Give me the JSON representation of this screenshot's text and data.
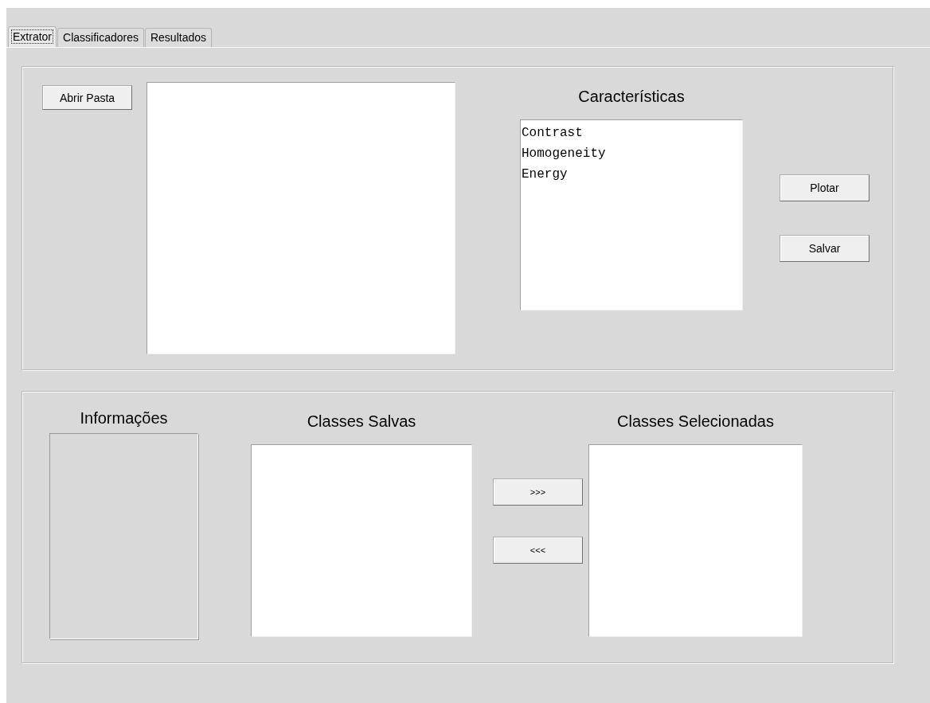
{
  "tabs": [
    {
      "label": "Extrator",
      "selected": true
    },
    {
      "label": "Classificadores",
      "selected": false
    },
    {
      "label": "Resultados",
      "selected": false
    }
  ],
  "extractor": {
    "open_button": "Abrir Pasta",
    "features_title": "Características",
    "features": [
      "Contrast",
      "Homogeneity",
      "Energy"
    ],
    "plot_button": "Plotar",
    "save_button": "Salvar"
  },
  "classes": {
    "info_title": "Informações",
    "saved_title": "Classes Salvas",
    "selected_title": "Classes Selecionadas",
    "add_button": ">>>",
    "remove_button": "<<<"
  }
}
